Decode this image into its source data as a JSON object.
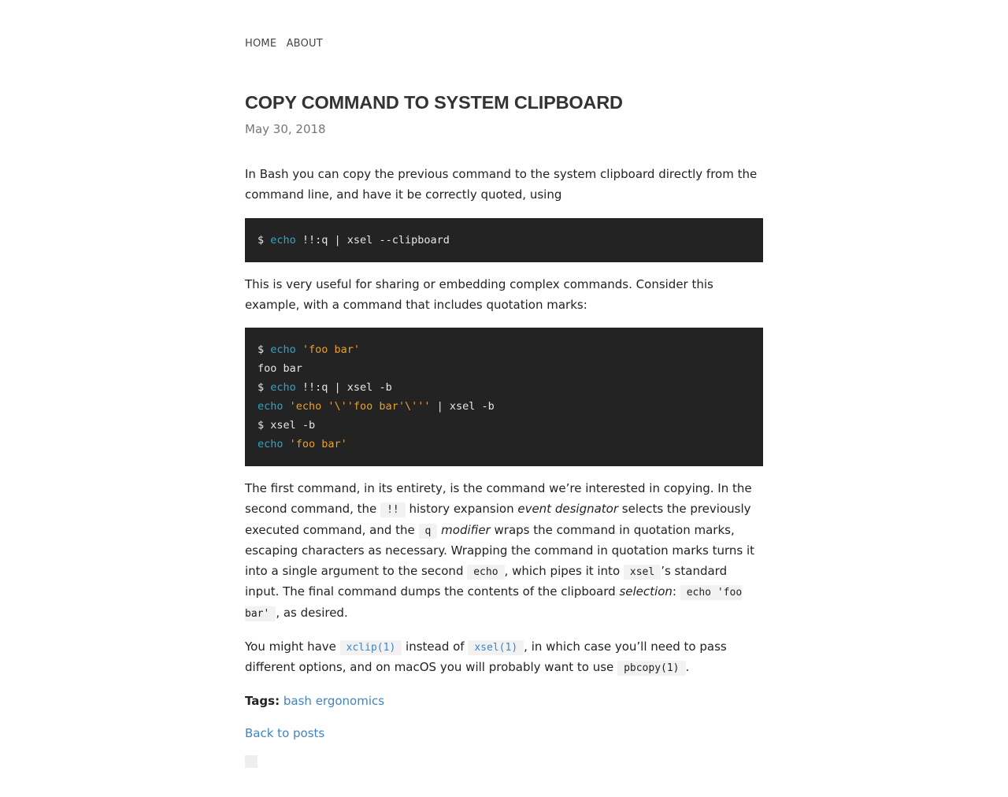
{
  "nav": {
    "home": "HOME",
    "about": "ABOUT"
  },
  "post": {
    "title": "COPY COMMAND TO SYSTEM CLIPBOARD",
    "date": "May 30, 2018",
    "intro": "In Bash you can copy the previous command to the system clipboard directly from the command line, and have it be correctly quoted, using",
    "code1": {
      "prompt": "$ ",
      "cmd": "echo",
      "rest": " !!:q | xsel --clipboard"
    },
    "p2": "This is very useful for sharing or embedding complex commands. Consider this example, with a command that includes quotation marks:",
    "code2": {
      "l1_prompt": "$ ",
      "l1_cmd": "echo",
      "l1_str": " 'foo bar'",
      "l2": "foo bar",
      "l3_prompt": "$ ",
      "l3_cmd": "echo",
      "l3_rest": " !!:q | xsel -b",
      "l4_cmd": "echo",
      "l4_str": " 'echo '\\''foo bar'\\'''",
      "l4_rest": " | xsel -b",
      "l5": "$ xsel -b",
      "l6_cmd": "echo",
      "l6_str": " 'foo bar'"
    },
    "p3": {
      "t1": "The first command, in its entirety, is the command we’re interested in copying. In the second command, the ",
      "c1": "!!",
      "t2": " history expansion ",
      "e1": "event designator",
      "t3": " selects the previously executed command, and the ",
      "c2": "q",
      "t4": " ",
      "e2": "modifier",
      "t5": " wraps the command in quotation marks, escaping characters as necessary. Wrapping the command in quotation marks turns it into a single argument to the second ",
      "c3": "echo",
      "t6": ", which pipes it into ",
      "c4": "xsel",
      "t7": "’s standard input. The final command dumps the contents of the clipboard ",
      "e3": "selection",
      "t8": ": ",
      "c5": "echo 'foo bar'",
      "t9": ", as desired."
    },
    "p4": {
      "t1": "You might have ",
      "l1": "xclip(1)",
      "t2": " instead of ",
      "l2": "xsel(1)",
      "t3": ", in which case you’ll need to pass different options, and on macOS you will probably want to use ",
      "c1": "pbcopy(1)",
      "t4": "."
    },
    "tags_label": "Tags:",
    "tags": [
      "bash",
      "ergonomics"
    ],
    "back": "Back to posts"
  }
}
